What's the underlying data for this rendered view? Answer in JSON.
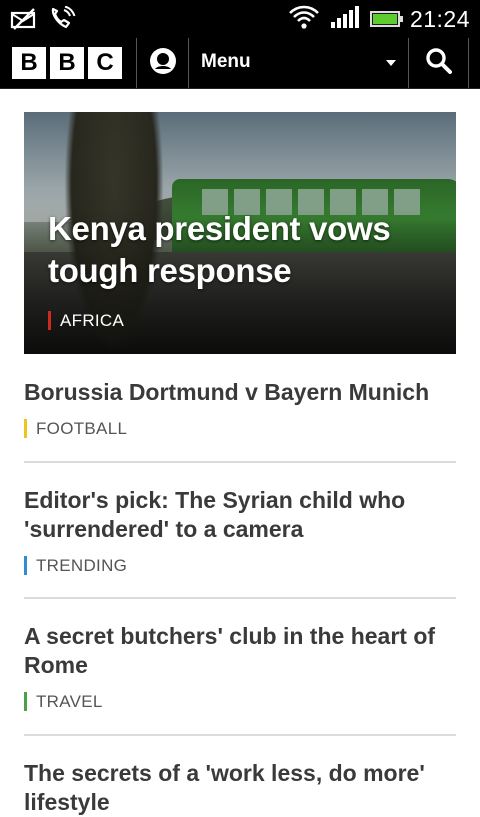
{
  "status_bar": {
    "time": "21:24",
    "icons": [
      "envelope-slashed-icon",
      "phone-icon",
      "wifi-icon",
      "signal-icon",
      "battery-icon"
    ],
    "battery_color": "#5ecb2f"
  },
  "header": {
    "logo_letters": [
      "B",
      "B",
      "C"
    ],
    "menu_label": "Menu",
    "icons": [
      "live-radio-icon",
      "dropdown-caret-icon",
      "search-icon"
    ]
  },
  "hero": {
    "title": "Kenya president vows tough response",
    "tag": "AFRICA",
    "tag_color": "#cc2c1f"
  },
  "stories": [
    {
      "title": "Borussia Dortmund v Bayern Munich",
      "tag": "FOOTBALL",
      "tag_color": "#f0c419"
    },
    {
      "title": "Editor's pick: The Syrian child who 'surrendered' to a camera",
      "tag": "TRENDING",
      "tag_color": "#2f8ecf"
    },
    {
      "title": "A secret butchers' club in the heart of Rome",
      "tag": "TRAVEL",
      "tag_color": "#4aa14a"
    },
    {
      "title": "The secrets of a 'work less, do more' lifestyle",
      "tag": "",
      "tag_color": ""
    }
  ]
}
